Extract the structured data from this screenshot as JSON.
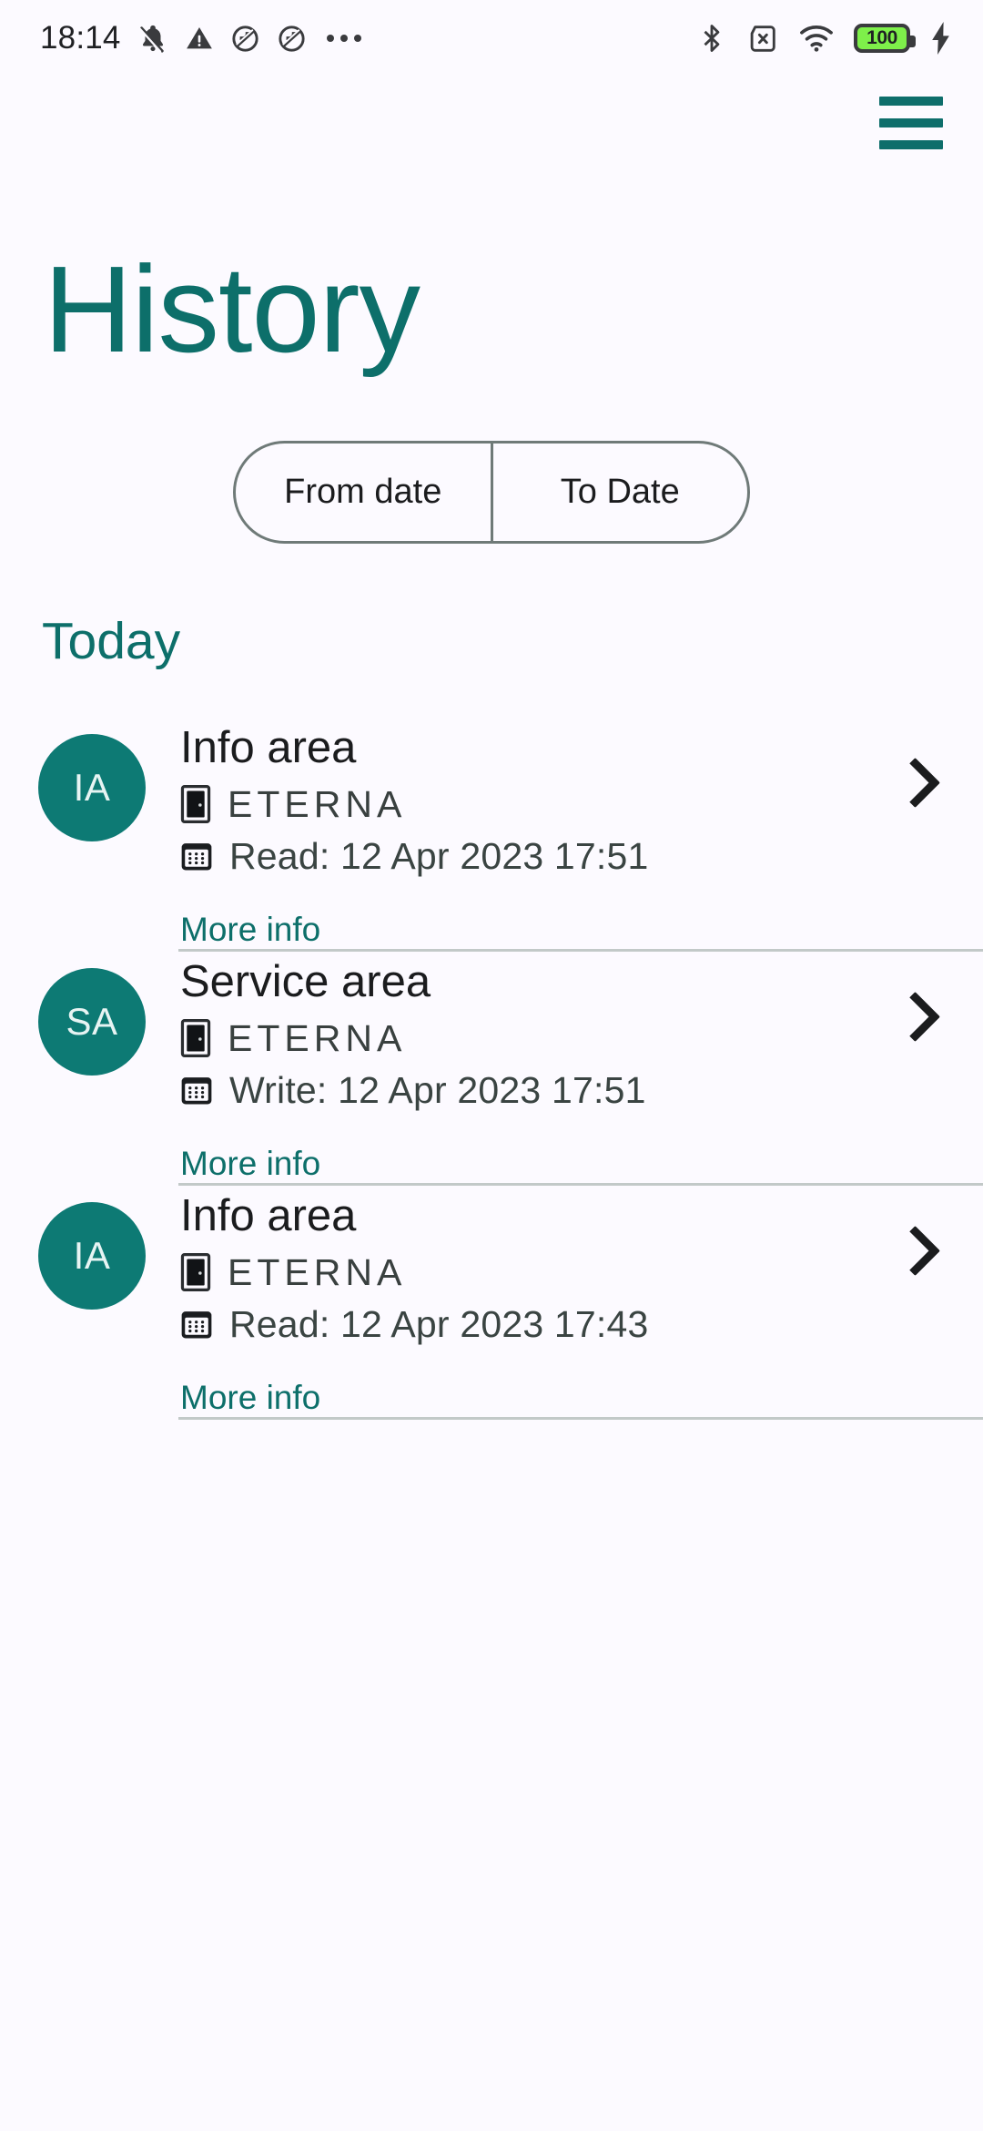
{
  "status_bar": {
    "clock": "18:14",
    "battery_percent": "100",
    "left_icons": [
      "notifications-off-icon",
      "warning-icon",
      "data-saver-off-icon",
      "data-saver-off-icon-2",
      "overflow-dots-icon"
    ],
    "right_icons": [
      "bluetooth-icon",
      "no-sim-icon",
      "wifi-icon",
      "battery-icon",
      "charging-bolt-icon"
    ]
  },
  "appbar": {
    "menu_icon": "hamburger-menu-icon"
  },
  "header": {
    "title": "History"
  },
  "date_range": {
    "from_label": "From date",
    "to_label": "To Date"
  },
  "sections": [
    {
      "label": "Today",
      "entries": [
        {
          "initials": "IA",
          "title": "Info area",
          "device_icon": "door-icon",
          "device": "ETERNA",
          "event_icon": "calendar-icon",
          "event": "Read: 12 Apr 2023 17:51",
          "more_label": "More info",
          "chevron": "chevron-right-icon"
        },
        {
          "initials": "SA",
          "title": "Service area",
          "device_icon": "door-icon",
          "device": "ETERNA",
          "event_icon": "calendar-icon",
          "event": "Write: 12 Apr 2023 17:51",
          "more_label": "More info",
          "chevron": "chevron-right-icon"
        },
        {
          "initials": "IA",
          "title": "Info area",
          "device_icon": "door-icon",
          "device": "ETERNA",
          "event_icon": "calendar-icon",
          "event": "Read: 12 Apr 2023 17:43",
          "more_label": "More info",
          "chevron": "chevron-right-icon"
        }
      ]
    }
  ],
  "colors": {
    "accent": "#0d6f6a",
    "avatar": "#0d7a74",
    "background": "#fcfaff",
    "text": "#1b1c1e",
    "divider": "#c2c9c8",
    "battery_fill": "#7ef04a"
  }
}
